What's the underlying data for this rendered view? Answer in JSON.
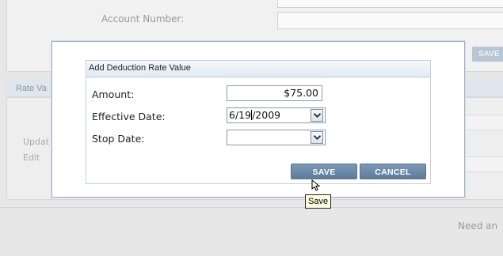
{
  "background": {
    "account_number_label": "Account Number:",
    "save_label": "SAVE",
    "rate_section_label": "Rate Va",
    "update_link": "Updat",
    "edit_link": "Edit",
    "footer_text": "Need an"
  },
  "dialog": {
    "title": "Add Deduction Rate Value",
    "fields": {
      "amount_label": "Amount:",
      "amount_value": "$75.00",
      "effective_date_label": "Effective Date:",
      "effective_date_before_caret": "6/19",
      "effective_date_after_caret": "/2009",
      "stop_date_label": "Stop Date:",
      "stop_date_value": ""
    },
    "buttons": {
      "save": "SAVE",
      "cancel": "CANCEL"
    },
    "tooltip": "Save"
  },
  "icons": {
    "dropdown": "chevron-down-icon",
    "cursor": "mouse-pointer-icon"
  },
  "colors": {
    "button_bg": "#6b89a8",
    "header_bg": "#e2eaf3",
    "tooltip_bg": "#ffffe1"
  }
}
